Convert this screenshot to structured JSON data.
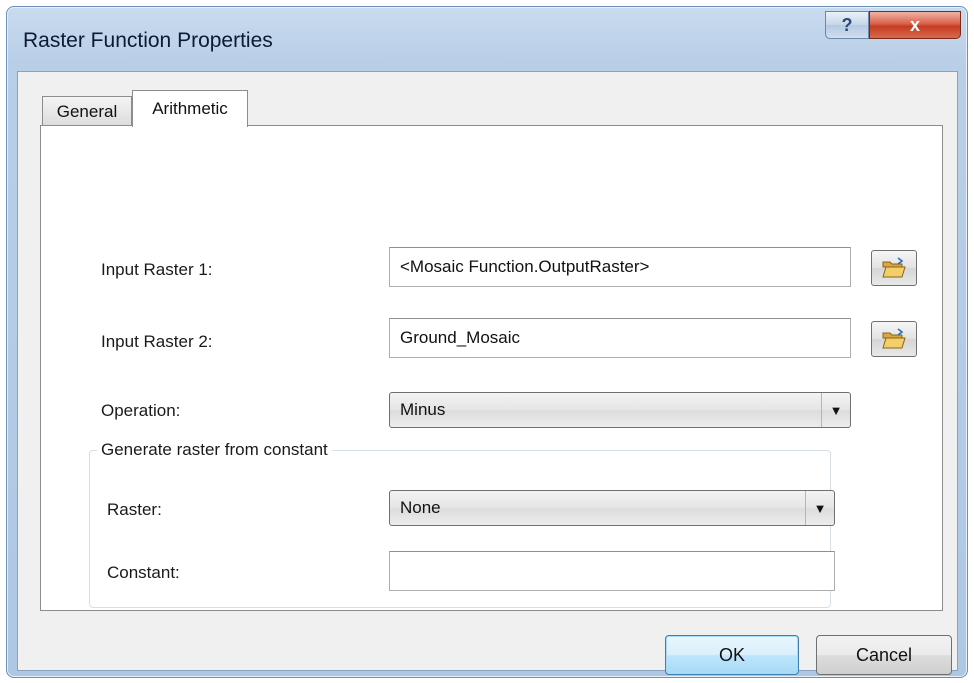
{
  "window": {
    "title": "Raster Function Properties",
    "help_glyph": "?",
    "close_glyph": "x"
  },
  "tabs": [
    {
      "label": "General",
      "selected": false
    },
    {
      "label": "Arithmetic",
      "selected": true
    }
  ],
  "form": {
    "input_raster_1": {
      "label": "Input Raster 1:",
      "value": "<Mosaic Function.OutputRaster>"
    },
    "input_raster_2": {
      "label": "Input Raster 2:",
      "value": "Ground_Mosaic"
    },
    "operation": {
      "label": "Operation:",
      "value": "Minus"
    }
  },
  "constant_group": {
    "title": "Generate raster from constant",
    "raster": {
      "label": "Raster:",
      "value": "None"
    },
    "constant": {
      "label": "Constant:",
      "value": ""
    }
  },
  "buttons": {
    "ok": "OK",
    "cancel": "Cancel"
  },
  "icons": {
    "browse": "folder-open-icon",
    "dropdown": "chevron-down-icon"
  },
  "colors": {
    "titlebar": "#b9cfe7",
    "close_button": "#c63c22",
    "ok_button_border": "#3c7fb1",
    "dialog_background": "#f0f0f0",
    "panel_background": "#ffffff"
  }
}
